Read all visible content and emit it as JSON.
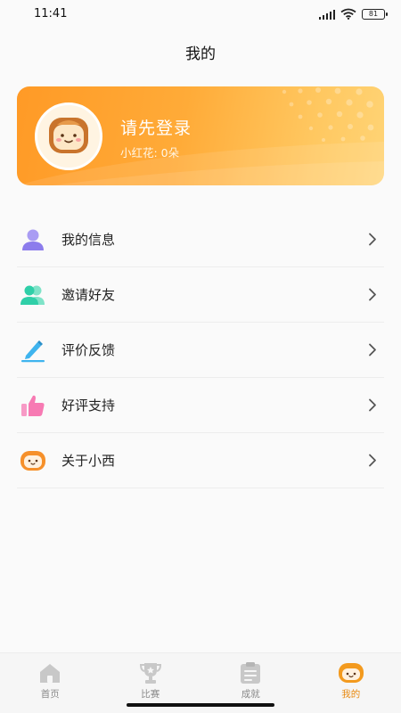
{
  "status_bar": {
    "time": "11:41",
    "battery": "81"
  },
  "header": {
    "title": "我的"
  },
  "profile": {
    "title": "请先登录",
    "subtitle": "小红花: 0朵"
  },
  "menu": {
    "items": [
      {
        "label": "我的信息",
        "icon": "user-icon",
        "color": "#9b8df0"
      },
      {
        "label": "邀请好友",
        "icon": "friends-icon",
        "color": "#2fcfa8"
      },
      {
        "label": "评价反馈",
        "icon": "pencil-icon",
        "color": "#3fb4ee"
      },
      {
        "label": "好评支持",
        "icon": "thumbs-up-icon",
        "color": "#f77ab3"
      },
      {
        "label": "关于小西",
        "icon": "mascot-icon",
        "color": "#f6902a"
      }
    ]
  },
  "tab_bar": {
    "tabs": [
      {
        "label": "首页",
        "icon": "home-icon",
        "active": false
      },
      {
        "label": "比赛",
        "icon": "trophy-icon",
        "active": false
      },
      {
        "label": "成就",
        "icon": "clipboard-icon",
        "active": false
      },
      {
        "label": "我的",
        "icon": "mascot-icon",
        "active": true
      }
    ]
  },
  "colors": {
    "accent": "#f39a1e",
    "card_gradient_start": "#ff9a26",
    "card_gradient_end": "#ffd476",
    "inactive_tab": "#c8c8c8"
  }
}
